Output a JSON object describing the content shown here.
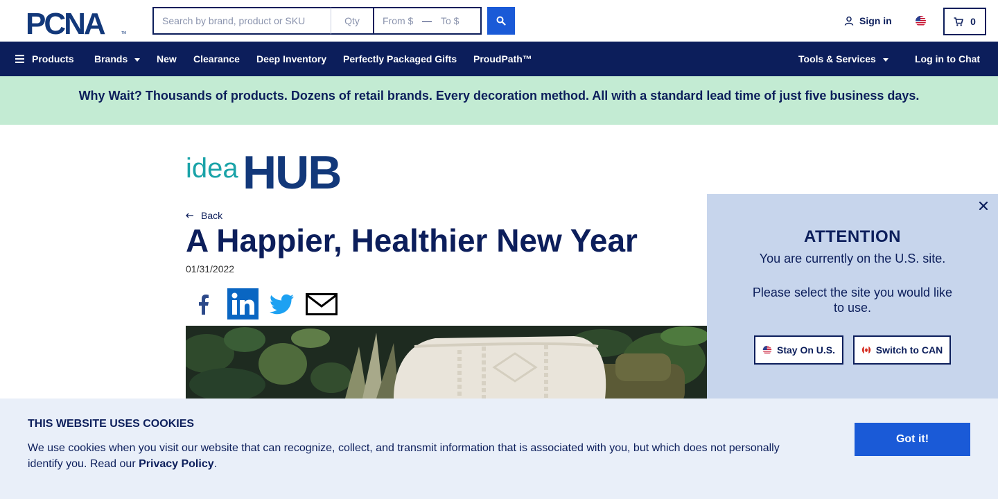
{
  "header": {
    "logo_text": "PCNA",
    "search_placeholder": "Search by brand, product or SKU",
    "qty_placeholder": "Qty",
    "price_from_placeholder": "From $",
    "price_to_placeholder": "To $",
    "price_separator": "—",
    "signin_label": "Sign in",
    "cart_count": "0"
  },
  "nav": {
    "products": "Products",
    "brands": "Brands",
    "new": "New",
    "clearance": "Clearance",
    "deep_inventory": "Deep Inventory",
    "perfectly_packaged_gifts": "Perfectly Packaged Gifts",
    "proudpath": "ProudPath™",
    "tools_services": "Tools & Services",
    "login_chat": "Log in to Chat"
  },
  "promo": {
    "text": "Why Wait? Thousands of products. Dozens of retail brands. Every decoration method. All with a standard lead time of just five business days."
  },
  "article": {
    "brand_logo_light": "idea",
    "brand_logo_bold": "HUB",
    "back_label": "Back",
    "title": "A Happier, Healthier New Year",
    "date": "01/31/2022"
  },
  "attention": {
    "title": "ATTENTION",
    "line1": "You are currently on the U.S. site.",
    "line2": "Please select the site you would like to use.",
    "stay_label": "Stay On U.S.",
    "switch_label": "Switch to CAN"
  },
  "cookie": {
    "title": "THIS WEBSITE USES COOKIES",
    "body": "We use cookies when you visit our website that can recognize, collect, and transmit information that is associated with you, but which does not personally identify you. Read our ",
    "policy_link": "Privacy Policy",
    "period": ".",
    "button": "Got it!"
  },
  "colors": {
    "navy": "#0c1e5b",
    "brand_blue": "#1a5ad7",
    "promo_green": "#c3ebd3",
    "popup_blue": "#c7d5ec",
    "cookie_bg": "#e9eff9",
    "idea_teal": "#1aa3a8",
    "hub_navy": "#12387a"
  }
}
